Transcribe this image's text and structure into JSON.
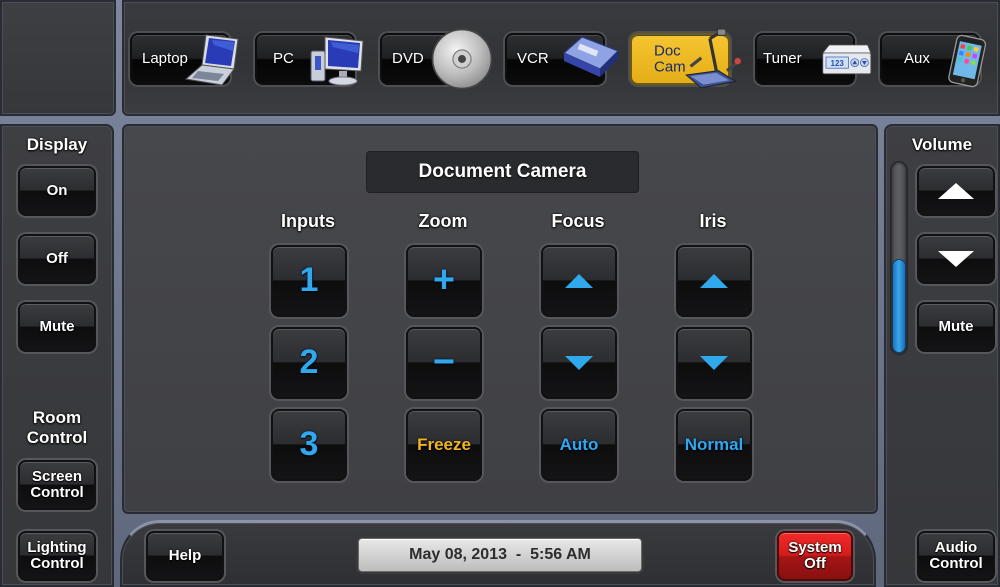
{
  "sources": [
    {
      "label": "Laptop",
      "icon": "laptop-icon",
      "active": false
    },
    {
      "label": "PC",
      "icon": "desktop-pc-icon",
      "active": false
    },
    {
      "label": "DVD",
      "icon": "dvd-disc-icon",
      "active": false
    },
    {
      "label": "VCR",
      "icon": "vhs-tape-icon",
      "active": false
    },
    {
      "label": "Doc\nCam",
      "icon": "document-camera-icon",
      "active": true
    },
    {
      "label": "Tuner",
      "icon": "tuner-box-icon",
      "active": false
    },
    {
      "label": "Aux",
      "icon": "media-player-icon",
      "active": false
    }
  ],
  "tuner_display": "123",
  "display": {
    "title": "Display",
    "on_label": "On",
    "off_label": "Off",
    "mute_label": "Mute"
  },
  "room_control": {
    "title": "Room\nControl",
    "screen_label": "Screen\nControl",
    "lighting_label": "Lighting\nControl"
  },
  "main": {
    "title": "Document Camera",
    "columns": {
      "inputs": "Inputs",
      "zoom": "Zoom",
      "focus": "Focus",
      "iris": "Iris"
    },
    "inputs": [
      "1",
      "2",
      "3"
    ],
    "zoom": {
      "in": "+",
      "out": "−",
      "freeze": "Freeze"
    },
    "focus": {
      "auto": "Auto"
    },
    "iris": {
      "normal": "Normal"
    }
  },
  "volume": {
    "title": "Volume",
    "level_percent": 50,
    "mute_label": "Mute",
    "fill_color": "#3aa6ea"
  },
  "bottom": {
    "help_label": "Help",
    "datetime": "May 08, 2013  -  5:56 AM",
    "system_off_label": "System\nOff",
    "audio_control_label": "Audio\nControl"
  },
  "colors": {
    "accent_blue": "#2fa9ec",
    "freeze_yellow": "#f3b41c",
    "active_source": "#f5c531",
    "system_off_red": "#d41c1c"
  }
}
